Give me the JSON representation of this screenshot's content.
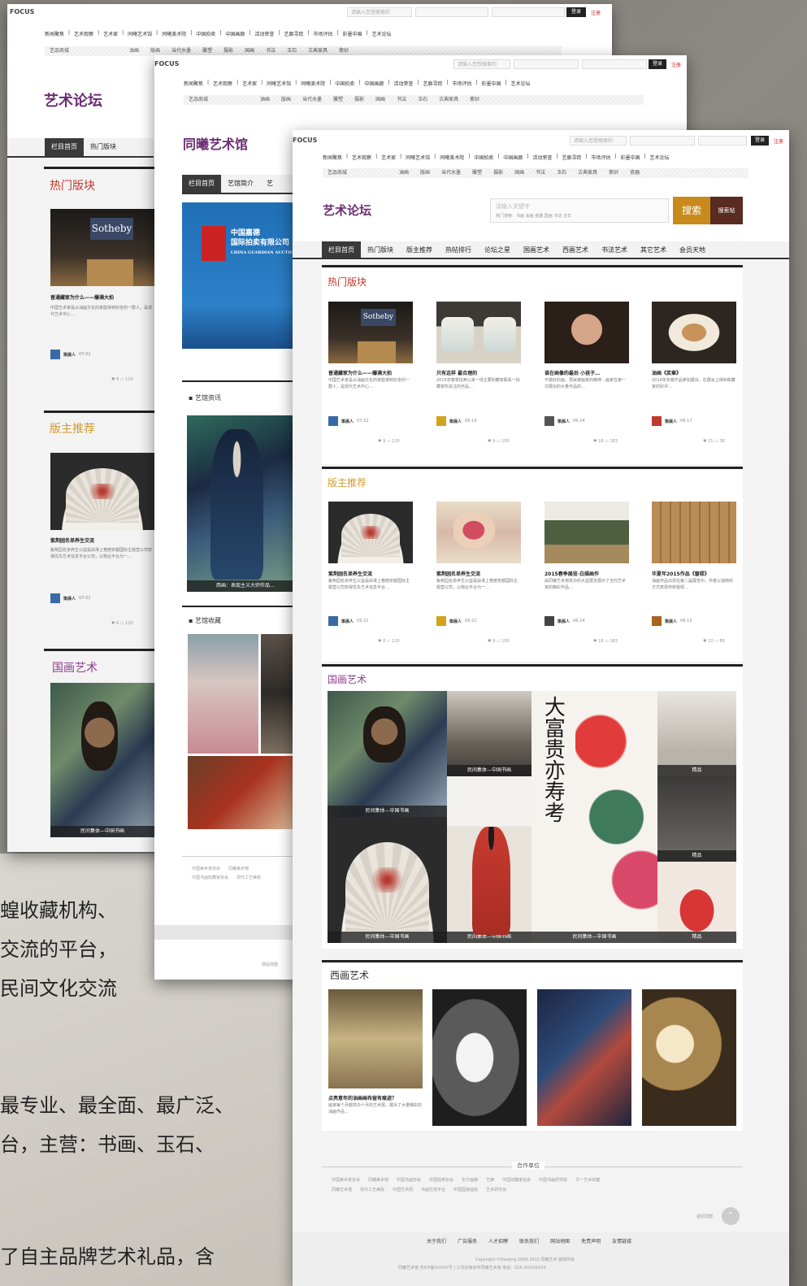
{
  "background": {
    "text_lines": [
      "蝗收藏机构、",
      "交流的平台，",
      "民间文化交流",
      "最专业、最全面、最广泛、",
      "台，主营：书画、玉石、",
      "了自主品牌艺术礼品，含"
    ]
  },
  "common": {
    "logo": "FOCUS",
    "search_placeholder": "请输入您想搜索的",
    "login": "登录",
    "register": "注册",
    "nav": [
      "新闻聚焦",
      "艺术观察",
      "艺术家",
      "同曦艺术馆",
      "同曦美术院",
      "中国拍卖",
      "中国画廊",
      "活动荣誉",
      "艺廊寻踪",
      "市场评估",
      "彩墨中国",
      "艺术论坛"
    ],
    "subnav_label": "艺品商城",
    "subnav": [
      "油画",
      "版画",
      "当代水墨",
      "雕塑",
      "摄影",
      "国画",
      "书法",
      "玉石",
      "古典家具",
      "紫砂",
      "瓷器"
    ]
  },
  "page1": {
    "site_title": "艺术论坛",
    "menu": [
      "栏目首页",
      "热门版块"
    ],
    "section_hot": "热门版块",
    "hot_item": {
      "title": "普通藏家为什么——爆满大拍",
      "desc": "中国艺术家是从油画文化的家庭得到好坐的一群人，是现代艺术中心…",
      "author": "策展人",
      "date": "07-02",
      "stats": "♥ 6   ▭ 120"
    },
    "section_mod": "版主推荐",
    "mod_item": {
      "title": "紫荆园名单养生交流",
      "desc": "紫荆园名单养生公益是由淮上艳丽安都国际主题营公司安得优先艺术信息平台公司，以物业平台为一…",
      "author": "策展人",
      "date": "07-02",
      "stats": "♥ 6   ▭ 120"
    },
    "section_guohua": "国画艺术",
    "guohua_caption": "民间集体—中国书画"
  },
  "page2": {
    "site_title": "同曦艺术馆",
    "menu": [
      "栏目首页",
      "艺馆简介",
      "艺"
    ],
    "ad_text": [
      "中国嘉德",
      "国际拍卖有限公司",
      "CHINA GUARDIAN AUCTIONS"
    ],
    "section_news": "艺馆资讯",
    "news_caption": "西画：表现主义大师作品…",
    "section_collect": "艺馆收藏",
    "footer_links": [
      "中国美术家协会",
      "同曦美术馆",
      "中国书画收藏家协会",
      "现代工艺美院"
    ],
    "footer_note": "网站地图"
  },
  "page3": {
    "site_title": "艺术论坛",
    "search_placeholder": "请输入关键字",
    "search_hint": "热门搜索：书画 油画 瓷器 国画 书法 玉石",
    "search_btn": "搜索",
    "search_btn2": "搜索帖",
    "menu": [
      "栏目首页",
      "热门版块",
      "版主推荐",
      "热帖排行",
      "论坛之星",
      "国画艺术",
      "西画艺术",
      "书法艺术",
      "其它艺术",
      "会员天地"
    ],
    "section_hot": "热门版块",
    "hot_items": [
      {
        "title": "普通藏家为什么——爆满大拍",
        "desc": "中国艺术家是从油画文化的家庭得到好坐的一群人，是现代艺术中心…",
        "author": "策展人",
        "date": "07-22",
        "stats": "♥ 9   ▭ 120"
      },
      {
        "title": "只有这样 最合理的",
        "desc": "2015年春季拍卖以来一场主要的藏家联系一批藏家所关注的作品…",
        "author": "策展人",
        "date": "05-19",
        "stats": "♥ 9   ▭ 100"
      },
      {
        "title": "谁在画像的最后 小孩子…",
        "desc": "不做好的画，再就被画家的精神…画家在第一次展出的大量作品的…",
        "author": "策展人",
        "date": "06-24",
        "stats": "♥ 18   ▭ 183"
      },
      {
        "title": "油画《奖章》",
        "desc": "2014年年度作品参加展出，在展会上得到收藏家的好评…",
        "author": "策展人",
        "date": "06-17",
        "stats": "♥ 21   ▭ 38"
      }
    ],
    "section_mod": "版主推荐",
    "mod_items": [
      {
        "title": "紫荆园名单养生交流",
        "desc": "紫荆园名单养生公益是由淮上艳丽安都国际主题营公司安得优先艺术信息平台…",
        "author": "策展人",
        "date": "05-21",
        "stats": "♥ 8   ▭ 120"
      },
      {
        "title": "紫荆园名单养生交流",
        "desc": "紫荆园名单养生公益是由淮上艳丽安都国际主题营公司，以物业平台为一…",
        "author": "策展人",
        "date": "05-21",
        "stats": "♥ 9   ▭ 100"
      },
      {
        "title": "2015春季展览·白描画作",
        "desc": "由同曦艺术馆举办的大型展览展示了当代艺术家的精彩作品…",
        "author": "策展人",
        "date": "06-24",
        "stats": "♥ 18   ▭ 183"
      },
      {
        "title": "华夏年2015作品《窗棂》",
        "desc": "油画作品出现在第二届展览中，作者以独特的方式表现传统窗棂…",
        "author": "策展人",
        "date": "06-15",
        "stats": "♥ 22   ▭ 88"
      }
    ],
    "section_guohua": "国画艺术",
    "guohua_calligraphy": "大富贵亦寿考",
    "guohua_captions": [
      "民间集体—中国书画",
      "民间集体—中国书画",
      "民间集体—中国书画",
      "民间集体—中国书画",
      "民间集体—中国书画",
      "精品",
      "精品",
      "精品"
    ],
    "section_xihua": "西画艺术",
    "xihua_item": {
      "title": "点亮意年的油画画布留有痕迹？",
      "desc": "画家每个月都举办十月的艺术展，展出了大量精彩的油画作品…"
    },
    "partners_title": "合作单位",
    "partners": [
      "中国美术家协会",
      "同曦美术馆",
      "中国书画协会",
      "中国拍卖协会",
      "东方画廊",
      "艺廊",
      "中国收藏家协会",
      "中国书画研究院",
      "华一艺术收藏"
    ],
    "partners2": [
      "同曦艺术馆",
      "现代工艺美院",
      "中国艺术网",
      "书画交流平台",
      "中国国家画院",
      "艺术研究会"
    ],
    "back_top": "返回顶部",
    "footer_links": [
      "关于我们",
      "广告服务",
      "人才招聘",
      "联系我们",
      "网站地图",
      "免责声明",
      "友情链接"
    ],
    "copyright": "Copyright ©Nanjing 2000-2015 同曦艺术 版权所有",
    "icp": "同曦艺术馆 苏ICP备XXXXX号 | 江苏省南京市同曦艺术馆 电话：025-XXXXXXXX"
  }
}
